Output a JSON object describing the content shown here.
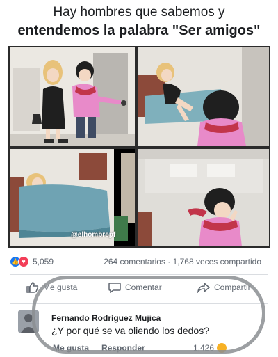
{
  "meme": {
    "title_line1": "Hay hombres que sabemos y",
    "title_line2": "entendemos la palabra \"Ser amigos\"",
    "watermark": "@elhombrepf"
  },
  "post_stats": {
    "reaction_count": "5,059",
    "comments": "264 comentarios",
    "separator": "·",
    "shares": "1,768 veces compartido"
  },
  "post_actions": {
    "like_label": "Me gusta",
    "comment_label": "Comentar",
    "share_label": "Compartir"
  },
  "comment": {
    "author": "Fernando Rodríguez Mujica",
    "text": "¿Y por qué se va oliendo los dedos?",
    "like_label": "Me gusta",
    "reply_label": "Responder",
    "reaction_count": "1,426"
  },
  "colors": {
    "facebook_blue": "#1877f2",
    "love_red": "#f33e58",
    "haha_yellow": "#f7b125",
    "highlight_gray": "#8b8e92"
  }
}
